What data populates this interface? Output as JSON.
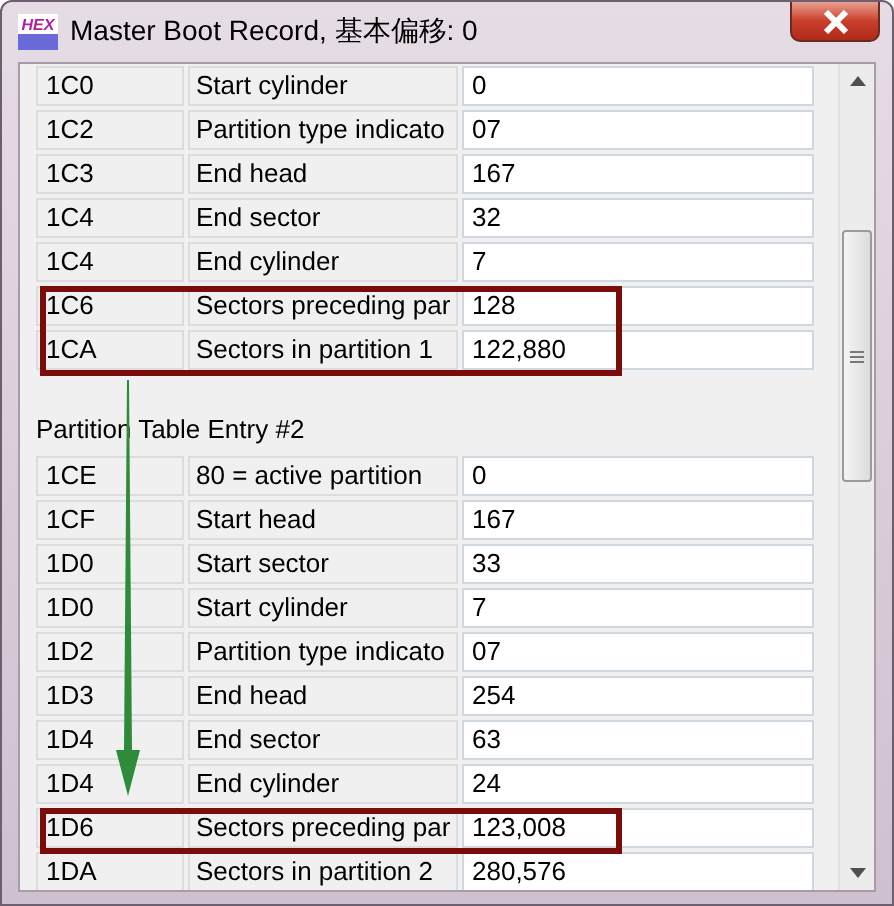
{
  "window": {
    "title": "Master Boot Record, 基本偏移: 0",
    "app_icon_text": "HEX"
  },
  "groups": [
    {
      "rows": [
        {
          "offset": "1C0",
          "description": "Start cylinder",
          "value": "0",
          "highlighted": false
        },
        {
          "offset": "1C2",
          "description": "Partition type indicato",
          "value": "07",
          "highlighted": false
        },
        {
          "offset": "1C3",
          "description": "End head",
          "value": "167",
          "highlighted": false
        },
        {
          "offset": "1C4",
          "description": "End sector",
          "value": "32",
          "highlighted": false
        },
        {
          "offset": "1C4",
          "description": "End cylinder",
          "value": "7",
          "highlighted": false
        },
        {
          "offset": "1C6",
          "description": "Sectors preceding par",
          "value": "128",
          "highlighted": true
        },
        {
          "offset": "1CA",
          "description": "Sectors in partition 1",
          "value": "122,880",
          "highlighted": true
        }
      ]
    },
    {
      "title": "Partition Table Entry #2",
      "rows": [
        {
          "offset": "1CE",
          "description": "80 = active partition",
          "value": "0",
          "highlighted": false
        },
        {
          "offset": "1CF",
          "description": "Start head",
          "value": "167",
          "highlighted": false
        },
        {
          "offset": "1D0",
          "description": "Start sector",
          "value": "33",
          "highlighted": false
        },
        {
          "offset": "1D0",
          "description": "Start cylinder",
          "value": "7",
          "highlighted": false
        },
        {
          "offset": "1D2",
          "description": "Partition type indicato",
          "value": "07",
          "highlighted": false
        },
        {
          "offset": "1D3",
          "description": "End head",
          "value": "254",
          "highlighted": false
        },
        {
          "offset": "1D4",
          "description": "End sector",
          "value": "63",
          "highlighted": false
        },
        {
          "offset": "1D4",
          "description": "End cylinder",
          "value": "24",
          "highlighted": false
        },
        {
          "offset": "1D6",
          "description": "Sectors preceding par",
          "value": "123,008",
          "highlighted": true
        },
        {
          "offset": "1DA",
          "description": "Sectors in partition 2",
          "value": "280,576",
          "highlighted": false
        }
      ]
    }
  ]
}
